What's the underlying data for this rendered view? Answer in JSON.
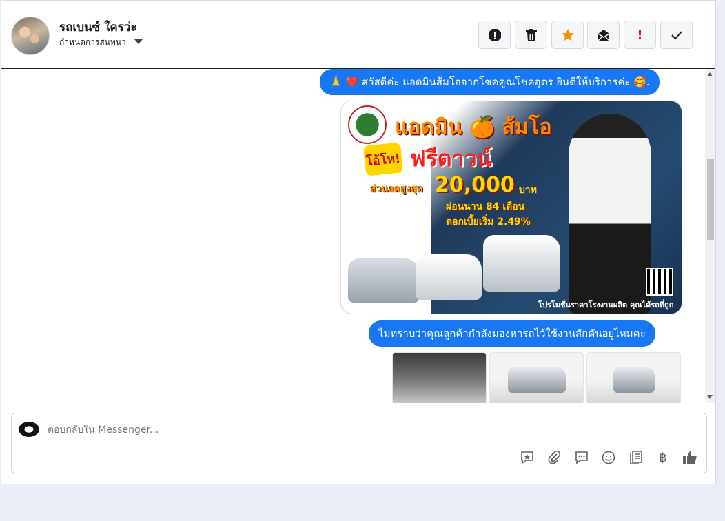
{
  "header": {
    "contact_name": "รถเบนซ์ ใครว่ะ",
    "contact_subtitle": "กำหนดการสนทนา",
    "toolbar": [
      {
        "name": "report-icon",
        "color": "#1c1e21"
      },
      {
        "name": "trash-icon",
        "color": "#1c1e21"
      },
      {
        "name": "star-icon",
        "color": "#f4900c"
      },
      {
        "name": "mail-read-icon",
        "color": "#1c1e21"
      },
      {
        "name": "exclamation-icon",
        "color": "#e02020"
      },
      {
        "name": "check-icon",
        "color": "#1c1e21"
      }
    ]
  },
  "messages": {
    "greeting": "🙏 ❤️ สวัสดีค่ะ แอดมินส้มโอจากโชคคูณโชคอุตร ยินดีให้บริการค่ะ 🥰.",
    "promo": {
      "headline": "แอดมิน 🍊 ส้มโอ",
      "badge": "โอ้โห!",
      "sale": "ฟรีดาวน์",
      "discount_label": "ส่วนลดสูงสุด",
      "discount_amount": "20,000",
      "discount_unit": "บาท",
      "installment": "ผ่อนนาน 84 เดือน",
      "interest": "ดอกเบี้ยเริ่ม 2.49%",
      "footer": "โปรโมชั่นราคาโรงงานผลิต คุณได้รถที่ถูกกว่า"
    },
    "question": "ไม่ทราบว่าคุณลูกค้ากำลังมองหารถไว้ใช้งานสักคันอยู่ไหมคะ"
  },
  "composer": {
    "placeholder": "ตอบกลับใน Messenger...",
    "icons": [
      "saved-reply-icon",
      "attachment-icon",
      "quick-reply-icon",
      "emoji-icon",
      "notes-icon",
      "baht-icon",
      "like-icon"
    ]
  },
  "colors": {
    "bubble": "#1877f2",
    "panel": "#ffffff",
    "background": "#e9edf5"
  }
}
